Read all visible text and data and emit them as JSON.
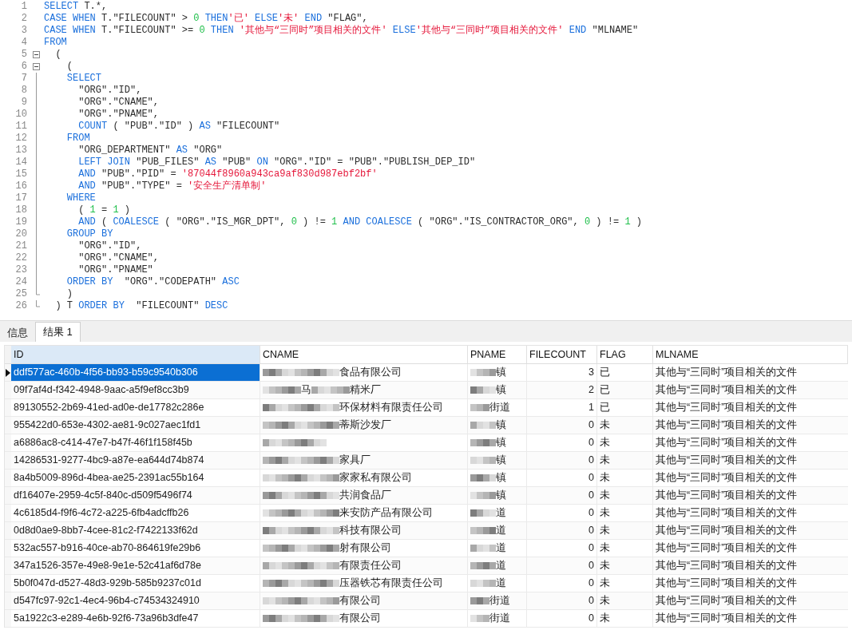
{
  "editor": {
    "lines": [
      {
        "number": "1",
        "tokens": [
          {
            "kind": "kw",
            "t": "SELECT"
          },
          {
            "kind": "plain",
            "t": " T.*,"
          }
        ]
      },
      {
        "number": "2",
        "tokens": [
          {
            "kind": "kw",
            "t": "CASE WHEN"
          },
          {
            "kind": "plain",
            "t": " T.\"FILECOUNT\" > "
          },
          {
            "kind": "num",
            "t": "0"
          },
          {
            "kind": "kw",
            "t": " THEN"
          },
          {
            "kind": "str",
            "t": "'已'"
          },
          {
            "kind": "kw",
            "t": " ELSE"
          },
          {
            "kind": "str",
            "t": "'未'"
          },
          {
            "kind": "kw",
            "t": " END"
          },
          {
            "kind": "plain",
            "t": " \"FLAG\","
          }
        ]
      },
      {
        "number": "3",
        "tokens": [
          {
            "kind": "kw",
            "t": "CASE WHEN"
          },
          {
            "kind": "plain",
            "t": " T.\"FILECOUNT\" >= "
          },
          {
            "kind": "num",
            "t": "0"
          },
          {
            "kind": "kw",
            "t": " THEN "
          },
          {
            "kind": "str",
            "t": "'其他与“三同时”项目相关的文件'"
          },
          {
            "kind": "kw",
            "t": " ELSE"
          },
          {
            "kind": "str",
            "t": "'其他与“三同时”项目相关的文件'"
          },
          {
            "kind": "kw",
            "t": " END"
          },
          {
            "kind": "plain",
            "t": " \"MLNAME\""
          }
        ]
      },
      {
        "number": "4",
        "tokens": [
          {
            "kind": "kw",
            "t": "FROM"
          }
        ]
      },
      {
        "number": "5",
        "kind": "open",
        "tokens": [
          {
            "kind": "plain",
            "t": "  ("
          }
        ]
      },
      {
        "number": "6",
        "kind": "open",
        "tokens": [
          {
            "kind": "plain",
            "t": "    ("
          }
        ]
      },
      {
        "number": "7",
        "kind": "line",
        "tokens": [
          {
            "kind": "kw",
            "t": "    SELECT"
          }
        ]
      },
      {
        "number": "8",
        "kind": "line",
        "tokens": [
          {
            "kind": "plain",
            "t": "      \"ORG\".\"ID\","
          }
        ]
      },
      {
        "number": "9",
        "kind": "line",
        "tokens": [
          {
            "kind": "plain",
            "t": "      \"ORG\".\"CNAME\","
          }
        ]
      },
      {
        "number": "10",
        "kind": "line",
        "tokens": [
          {
            "kind": "plain",
            "t": "      \"ORG\".\"PNAME\","
          }
        ]
      },
      {
        "number": "11",
        "kind": "line",
        "tokens": [
          {
            "kind": "kw",
            "t": "      COUNT"
          },
          {
            "kind": "plain",
            "t": " ( \"PUB\".\"ID\" ) "
          },
          {
            "kind": "kw",
            "t": "AS"
          },
          {
            "kind": "plain",
            "t": " \"FILECOUNT\""
          }
        ]
      },
      {
        "number": "12",
        "kind": "line",
        "tokens": [
          {
            "kind": "kw",
            "t": "    FROM"
          }
        ]
      },
      {
        "number": "13",
        "kind": "line",
        "tokens": [
          {
            "kind": "plain",
            "t": "      \"ORG_DEPARTMENT\" "
          },
          {
            "kind": "kw",
            "t": "AS"
          },
          {
            "kind": "plain",
            "t": " \"ORG\""
          }
        ]
      },
      {
        "number": "14",
        "kind": "line",
        "tokens": [
          {
            "kind": "kw",
            "t": "      LEFT JOIN"
          },
          {
            "kind": "plain",
            "t": " \"PUB_FILES\" "
          },
          {
            "kind": "kw",
            "t": "AS"
          },
          {
            "kind": "plain",
            "t": " \"PUB\" "
          },
          {
            "kind": "kw",
            "t": "ON"
          },
          {
            "kind": "plain",
            "t": " \"ORG\".\"ID\" = \"PUB\".\"PUBLISH_DEP_ID\""
          }
        ]
      },
      {
        "number": "15",
        "kind": "line",
        "tokens": [
          {
            "kind": "kw",
            "t": "      AND"
          },
          {
            "kind": "plain",
            "t": " \"PUB\".\"PID\" = "
          },
          {
            "kind": "str",
            "t": "'87044f8960a943ca9af830d987ebf2bf'"
          }
        ]
      },
      {
        "number": "16",
        "kind": "line",
        "tokens": [
          {
            "kind": "kw",
            "t": "      AND"
          },
          {
            "kind": "plain",
            "t": " \"PUB\".\"TYPE\" = "
          },
          {
            "kind": "str",
            "t": "'安全生产清单制'"
          }
        ]
      },
      {
        "number": "17",
        "kind": "line",
        "tokens": [
          {
            "kind": "kw",
            "t": "    WHERE"
          }
        ]
      },
      {
        "number": "18",
        "kind": "line",
        "tokens": [
          {
            "kind": "plain",
            "t": "      ( "
          },
          {
            "kind": "num",
            "t": "1"
          },
          {
            "kind": "plain",
            "t": " = "
          },
          {
            "kind": "num",
            "t": "1"
          },
          {
            "kind": "plain",
            "t": " )"
          }
        ]
      },
      {
        "number": "19",
        "kind": "line",
        "tokens": [
          {
            "kind": "kw",
            "t": "      AND"
          },
          {
            "kind": "plain",
            "t": " ( "
          },
          {
            "kind": "kw",
            "t": "COALESCE"
          },
          {
            "kind": "plain",
            "t": " ( \"ORG\".\"IS_MGR_DPT\", "
          },
          {
            "kind": "num",
            "t": "0"
          },
          {
            "kind": "plain",
            "t": " ) != "
          },
          {
            "kind": "num",
            "t": "1"
          },
          {
            "kind": "kw",
            "t": " AND COALESCE"
          },
          {
            "kind": "plain",
            "t": " ( \"ORG\".\"IS_CONTRACTOR_ORG\", "
          },
          {
            "kind": "num",
            "t": "0"
          },
          {
            "kind": "plain",
            "t": " ) != "
          },
          {
            "kind": "num",
            "t": "1"
          },
          {
            "kind": "plain",
            "t": " )"
          }
        ]
      },
      {
        "number": "20",
        "kind": "line",
        "tokens": [
          {
            "kind": "kw",
            "t": "    GROUP BY"
          }
        ]
      },
      {
        "number": "21",
        "kind": "line",
        "tokens": [
          {
            "kind": "plain",
            "t": "      \"ORG\".\"ID\","
          }
        ]
      },
      {
        "number": "22",
        "kind": "line",
        "tokens": [
          {
            "kind": "plain",
            "t": "      \"ORG\".\"CNAME\","
          }
        ]
      },
      {
        "number": "23",
        "kind": "line",
        "tokens": [
          {
            "kind": "plain",
            "t": "      \"ORG\".\"PNAME\""
          }
        ]
      },
      {
        "number": "24",
        "kind": "line",
        "tokens": [
          {
            "kind": "kw",
            "t": "    ORDER BY"
          },
          {
            "kind": "plain",
            "t": "  \"ORG\".\"CODEPATH\" "
          },
          {
            "kind": "kw",
            "t": "ASC"
          }
        ]
      },
      {
        "number": "25",
        "kind": "end",
        "tokens": [
          {
            "kind": "plain",
            "t": "    )"
          }
        ]
      },
      {
        "number": "26",
        "kind": "end",
        "tokens": [
          {
            "kind": "plain",
            "t": "  ) T "
          },
          {
            "kind": "kw",
            "t": "ORDER BY"
          },
          {
            "kind": "plain",
            "t": "  \"FILECOUNT\" "
          },
          {
            "kind": "kw",
            "t": "DESC"
          }
        ]
      }
    ]
  },
  "tabs": [
    {
      "label": "信息",
      "selected": false
    },
    {
      "label": "结果 1",
      "selected": true
    }
  ],
  "table": {
    "columns": [
      "ID",
      "CNAME",
      "PNAME",
      "FILECOUNT",
      "FLAG",
      "MLNAME"
    ],
    "rows": [
      {
        "selected": true,
        "id": "ddf577ac-460b-4f56-bb93-b59c9540b306",
        "cname": [
          "食品有限公司"
        ],
        "pname": "镇",
        "filecount": "3",
        "flag": "已",
        "mlname": "其他与“三同时”项目相关的文件"
      },
      {
        "selected": false,
        "id": "09f7af4d-f342-4948-9aac-a5f9ef8cc3b9",
        "cname": [
          "马",
          "精米厂"
        ],
        "pname": "镇",
        "filecount": "2",
        "flag": "已",
        "mlname": "其他与“三同时”项目相关的文件"
      },
      {
        "selected": false,
        "id": "89130552-2b69-41ed-ad0e-de17782c286e",
        "cname": [
          "环保材料有限责任公司"
        ],
        "pname": "街道",
        "filecount": "1",
        "flag": "已",
        "mlname": "其他与“三同时”项目相关的文件"
      },
      {
        "selected": false,
        "id": "955422d0-653e-4302-ae81-9c027aec1fd1",
        "cname": [
          "蒂斯沙发厂"
        ],
        "pname": "镇",
        "filecount": "0",
        "flag": "未",
        "mlname": "其他与“三同时”项目相关的文件"
      },
      {
        "selected": false,
        "id": "a6886ac8-c414-47e7-b47f-46f1f158f45b",
        "cname": [],
        "pname": "镇",
        "filecount": "0",
        "flag": "未",
        "mlname": "其他与“三同时”项目相关的文件"
      },
      {
        "selected": false,
        "id": "14286531-9277-4bc9-a87e-ea644d74b874",
        "cname": [
          "家具厂"
        ],
        "pname": "镇",
        "filecount": "0",
        "flag": "未",
        "mlname": "其他与“三同时”项目相关的文件"
      },
      {
        "selected": false,
        "id": "8a4b5009-896d-4bea-ae25-2391ac55b164",
        "cname": [
          "家家私有限公司"
        ],
        "pname": "镇",
        "filecount": "0",
        "flag": "未",
        "mlname": "其他与“三同时”项目相关的文件"
      },
      {
        "selected": false,
        "id": "df16407e-2959-4c5f-840c-d509f5496f74",
        "cname": [
          "共润食品厂"
        ],
        "pname": "镇",
        "filecount": "0",
        "flag": "未",
        "mlname": "其他与“三同时”项目相关的文件"
      },
      {
        "selected": false,
        "id": "4c6185d4-f9f6-4c72-a225-6fb4adcffb26",
        "cname": [
          "来安防产品有限公司"
        ],
        "pname": "道",
        "filecount": "0",
        "flag": "未",
        "mlname": "其他与“三同时”项目相关的文件"
      },
      {
        "selected": false,
        "id": "0d8d0ae9-8bb7-4cee-81c2-f7422133f62d",
        "cname": [
          "科技有限公司"
        ],
        "pname": "道",
        "filecount": "0",
        "flag": "未",
        "mlname": "其他与“三同时”项目相关的文件"
      },
      {
        "selected": false,
        "id": "532ac557-b916-40ce-ab70-864619fe29b6",
        "cname": [
          "射有限公司"
        ],
        "pname": "道",
        "filecount": "0",
        "flag": "未",
        "mlname": "其他与“三同时”项目相关的文件"
      },
      {
        "selected": false,
        "id": "347a1526-357e-49e8-9e1e-52c41af6d78e",
        "cname": [
          "有限责任公司"
        ],
        "pname": "道",
        "filecount": "0",
        "flag": "未",
        "mlname": "其他与“三同时”项目相关的文件"
      },
      {
        "selected": false,
        "id": "5b0f047d-d527-48d3-929b-585b9237c01d",
        "cname": [
          "压器铁芯有限责任公司"
        ],
        "pname": "道",
        "filecount": "0",
        "flag": "未",
        "mlname": "其他与“三同时”项目相关的文件"
      },
      {
        "selected": false,
        "id": "d547fc97-92c1-4ec4-96b4-c74534324910",
        "cname": [
          "有限公司"
        ],
        "pname": "街道",
        "filecount": "0",
        "flag": "未",
        "mlname": "其他与“三同时”项目相关的文件"
      },
      {
        "selected": false,
        "id": "5a1922c3-e289-4e6b-92f6-73a96b3dfe47",
        "cname": [
          "有限公司"
        ],
        "pname": "街道",
        "filecount": "0",
        "flag": "未",
        "mlname": "其他与“三同时”项目相关的文件"
      }
    ]
  }
}
